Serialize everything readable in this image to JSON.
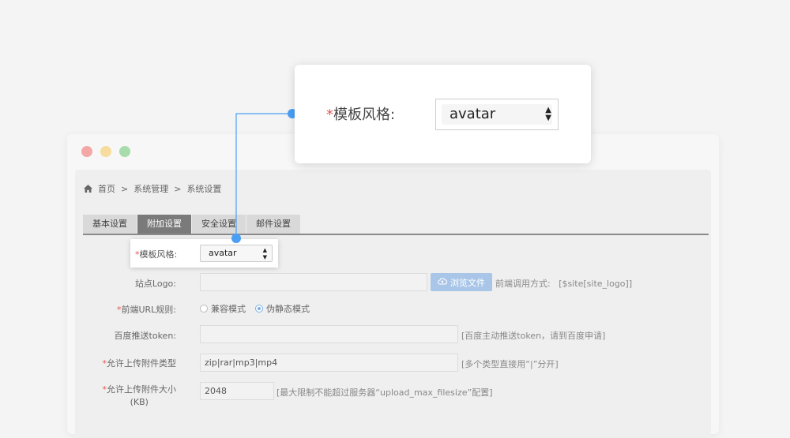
{
  "window": {
    "breadcrumb": {
      "home": "首页",
      "sep": ">",
      "level1": "系统管理",
      "level2": "系统设置"
    },
    "tabs": [
      {
        "label": "基本设置",
        "active": false
      },
      {
        "label": "附加设置",
        "active": true
      },
      {
        "label": "安全设置",
        "active": false
      },
      {
        "label": "邮件设置",
        "active": false
      }
    ]
  },
  "form": {
    "template_style": {
      "required_mark": "*",
      "label": "模板风格:",
      "value": "avatar"
    },
    "site_logo": {
      "label": "站点Logo:",
      "value": "",
      "browse_button": "浏览文件",
      "hint_prefix": "前端调用方式:",
      "hint_code": "[$site[site_logo]]"
    },
    "url_rule": {
      "required_mark": "*",
      "label": "前端URL规则:",
      "options": [
        {
          "label": "兼容模式",
          "checked": false
        },
        {
          "label": "伪静态模式",
          "checked": true
        }
      ]
    },
    "baidu_token": {
      "label": "百度推送token:",
      "value": "",
      "hint": "[百度主动推送token，请到百度申请]"
    },
    "upload_types": {
      "required_mark": "*",
      "label": "允许上传附件类型",
      "value": "zip|rar|mp3|mp4",
      "hint": "[多个类型直接用“|”分开]"
    },
    "upload_size": {
      "required_mark": "*",
      "label_line1": "允许上传附件大小",
      "label_line2": "(KB)",
      "value": "2048",
      "hint": "[最大限制不能超过服务器“upload_max_filesize”配置]"
    }
  },
  "zoom": {
    "required_mark": "*",
    "label": "模板风格:",
    "value": "avatar"
  },
  "colors": {
    "accent": "#4a9ff5",
    "required": "#e85555",
    "active_tab": "#7a7a7a",
    "button": "#a9c6e8"
  }
}
